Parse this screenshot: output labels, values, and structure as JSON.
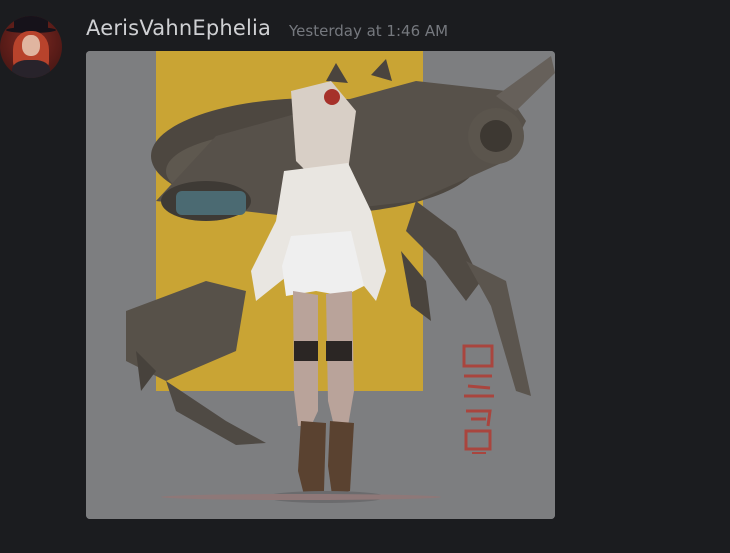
{
  "message": {
    "author": "AerisVahnEphelia",
    "timestamp": "Yesterday at 1:46 AM",
    "avatar": "user-avatar-red-hair-witch-hat",
    "attachment": {
      "kind": "image",
      "subject": "mecha-creature-and-anime-girl-artwork",
      "accent_colors": {
        "yellow": "#c9a434",
        "background": "#7d7e80",
        "ink_red": "#a9453e"
      }
    }
  },
  "theme": {
    "background": "#1b1c1f",
    "username_color": "#cfd0d3",
    "timestamp_color": "#75787e"
  }
}
